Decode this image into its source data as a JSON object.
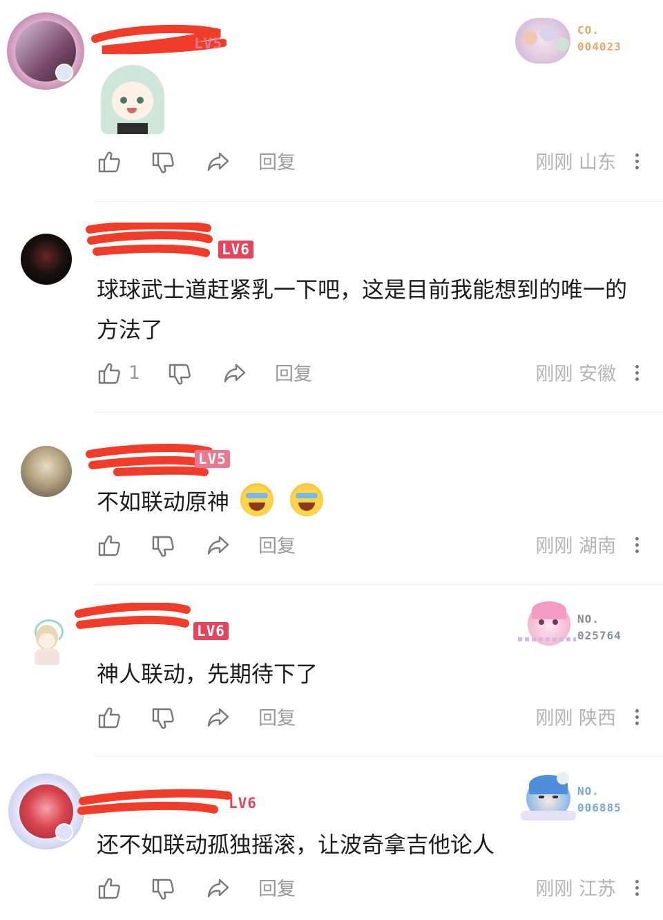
{
  "colors": {
    "lv5": "#e8788f",
    "lv6": "#e4455d",
    "redaction": "#f03c28",
    "badge_pink": "#e8a66a",
    "badge_blue": "#7aa6d6",
    "badge_gray": "#999999"
  },
  "icons": {
    "like": "thumbs-up-icon",
    "dislike": "thumbs-down-icon",
    "share": "share-arrow-icon",
    "more": "more-vertical-icon"
  },
  "comments": [
    {
      "level": "LV5",
      "text": "",
      "sticker": "anime-girl-sticker",
      "like_count": "",
      "reply_label": "回复",
      "time": "刚刚",
      "location": "山东",
      "badge_no_label": "CO.",
      "badge_no": "004023"
    },
    {
      "level": "LV6",
      "text": "球球武士道赶紧乳一下吧，这是目前我能想到的唯一的方法了",
      "like_count": "1",
      "reply_label": "回复",
      "time": "刚刚",
      "location": "安徽"
    },
    {
      "level": "LV5",
      "text": "不如联动原神",
      "emoji": [
        "laughing-crying-emoji",
        "laughing-crying-emoji"
      ],
      "like_count": "",
      "reply_label": "回复",
      "time": "刚刚",
      "location": "湖南"
    },
    {
      "level": "LV6",
      "text": "神人联动，先期待下了",
      "like_count": "",
      "reply_label": "回复",
      "time": "刚刚",
      "location": "陕西",
      "badge_no_label": "NO.",
      "badge_no": "025764"
    },
    {
      "level": "LV6",
      "text": "还不如联动孤独摇滚，让波奇拿吉他论人",
      "like_count": "",
      "reply_label": "回复",
      "time": "刚刚",
      "location": "江苏",
      "badge_no_label": "NO.",
      "badge_no": "006885"
    }
  ]
}
